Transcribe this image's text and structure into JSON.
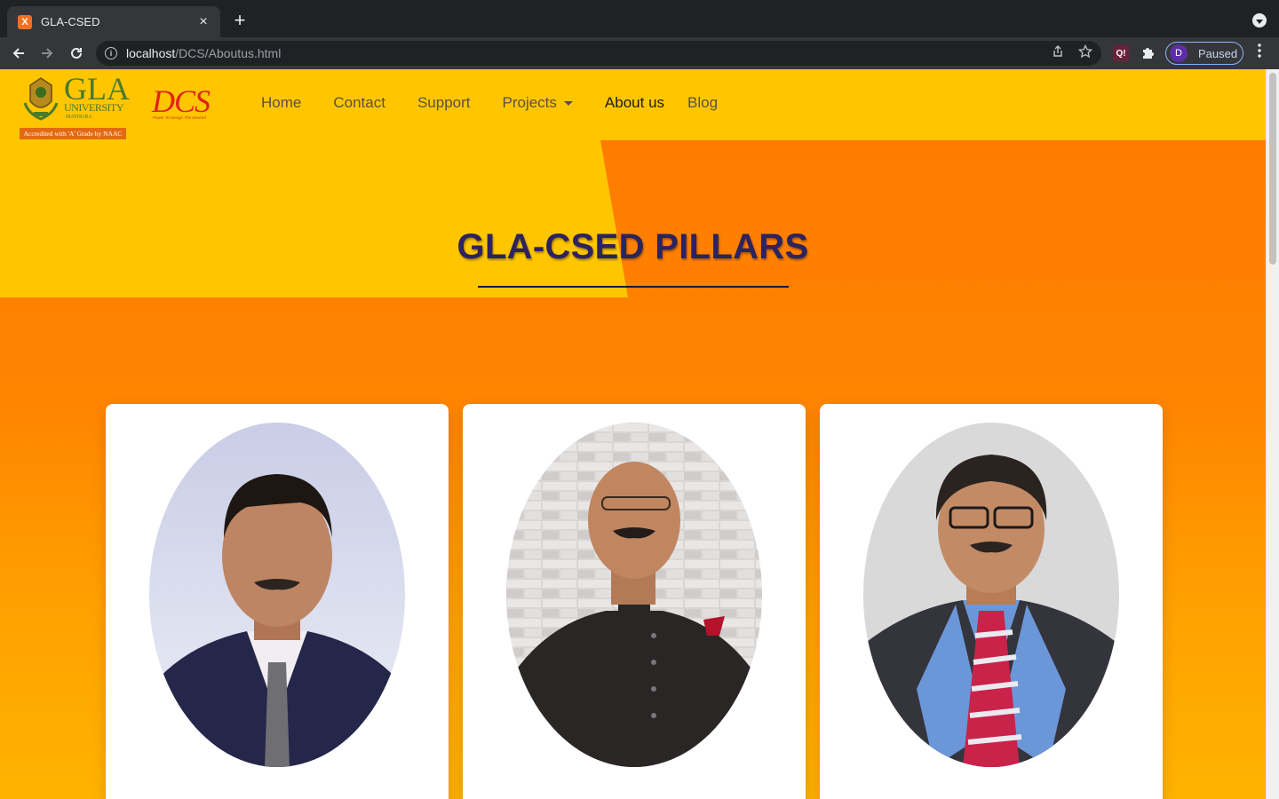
{
  "browser": {
    "tab_title": "GLA-CSED",
    "tab_favicon_glyph": "X",
    "new_tab_label": "+",
    "close_label": "×",
    "url_host": "localhost",
    "url_path": "/DCS/Aboutus.html",
    "extension_badge": "Q!",
    "profile_initial": "D",
    "profile_status": "Paused"
  },
  "logos": {
    "gla_name": "GLA",
    "gla_sub": "UNIVERSITY",
    "gla_city": "MATHURA",
    "gla_banner": "Accredited with 'A' Grade by NAAC",
    "dcs_name": "DCS",
    "dcs_tagline": "Power To Design The Desired"
  },
  "nav": {
    "items": [
      {
        "label": "Home"
      },
      {
        "label": "Contact"
      },
      {
        "label": "Support"
      },
      {
        "label": "Projects"
      },
      {
        "label": "About us"
      },
      {
        "label": "Blog"
      }
    ]
  },
  "hero": {
    "title": "GLA-CSED PILLARS"
  },
  "colors": {
    "navbar_bg": "#ffc600",
    "accent_orange": "#ff7a00",
    "title_color": "#2d235e",
    "browser_dark": "#202124"
  },
  "icons": [
    "back-arrow-icon",
    "forward-arrow-icon",
    "reload-icon",
    "info-icon",
    "share-icon",
    "star-icon",
    "puzzle-icon",
    "kebab-menu-icon",
    "tab-search-icon"
  ]
}
